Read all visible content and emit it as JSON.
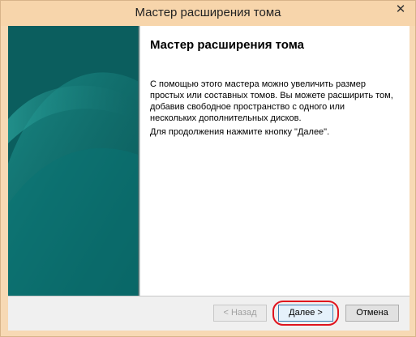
{
  "window": {
    "title": "Мастер расширения тома",
    "close_label": "✕"
  },
  "content": {
    "heading": "Мастер расширения тома",
    "description": "С помощью этого мастера можно увеличить размер простых или составных томов. Вы можете расширить том, добавив свободное пространство с одного или нескольких дополнительных дисков.",
    "hint": "Для продолжения нажмите кнопку \"Далее\"."
  },
  "buttons": {
    "back": "< Назад",
    "next": "Далее >",
    "cancel": "Отмена"
  },
  "colors": {
    "banner": "#0d6a6a",
    "highlight": "#e0141e"
  }
}
